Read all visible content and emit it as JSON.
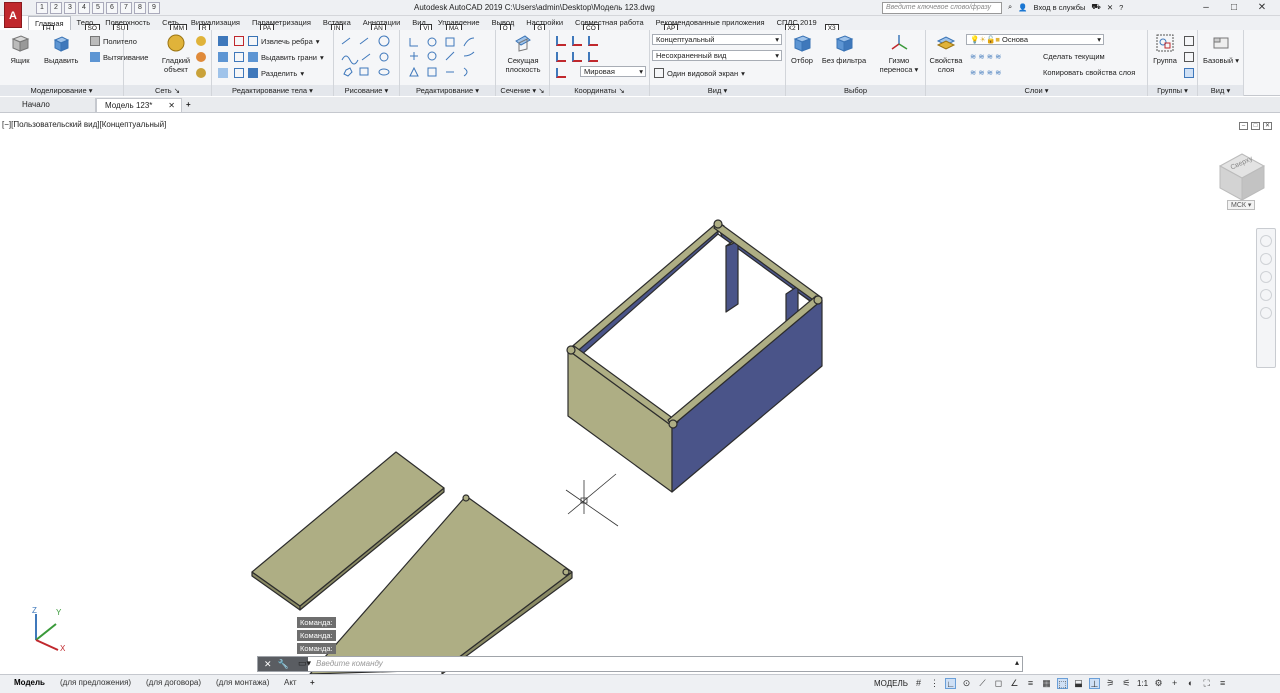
{
  "title_bar": {
    "app_letter": "A",
    "quick_access": [
      "1",
      "2",
      "3",
      "4",
      "5",
      "6",
      "7",
      "8",
      "9"
    ],
    "title": "Autodesk AutoCAD 2019    C:\\Users\\admin\\Desktop\\Модель 123.dwg",
    "search_placeholder": "Введите ключевое слово/фразу",
    "signin": "Вход в службы",
    "help": "?"
  },
  "ribbon_tabs": [
    {
      "label": "Главная",
      "key": "H"
    },
    {
      "label": "Тело",
      "key": "SO"
    },
    {
      "label": "Поверхность",
      "key": "SU"
    },
    {
      "label": "Сеть",
      "key": "MM"
    },
    {
      "label": "Визуализация",
      "key": "R"
    },
    {
      "label": "Параметризация",
      "key": "PA"
    },
    {
      "label": "Вставка",
      "key": "IN"
    },
    {
      "label": "Аннотации",
      "key": "AN"
    },
    {
      "label": "Вид",
      "key": "VI"
    },
    {
      "label": "Управление",
      "key": "MA"
    },
    {
      "label": "Вывод",
      "key": "O"
    },
    {
      "label": "Настройки",
      "key": "G"
    },
    {
      "label": "Совместная работа",
      "key": "CO"
    },
    {
      "label": "Рекомендованные приложения",
      "key": "AP"
    },
    {
      "label": "СПДС 2019",
      "key": "X2"
    }
  ],
  "extra_key": "X3",
  "panels": {
    "modeling": {
      "title": "Моделирование",
      "box": "Ящик",
      "extrude": "Выдавить",
      "polysolid": "Политело",
      "presspull": "Вытягивание"
    },
    "mesh": {
      "title": "Сеть",
      "smooth": "Гладкий объект"
    },
    "solid_edit": {
      "title": "Редактирование тела",
      "extract_edges": "Извлечь ребра",
      "extrude_faces": "Выдавить грани",
      "separate": "Разделить"
    },
    "draw": {
      "title": "Рисование"
    },
    "modify": {
      "title": "Редактирование"
    },
    "section": {
      "title": "Сечение",
      "plane": "Секущая плоскость"
    },
    "coordinates": {
      "title": "Координаты",
      "ucs": "Мировая"
    },
    "view": {
      "title": "Вид",
      "visual_style": "Концептуальный",
      "named_view": "Несохраненный вид",
      "viewports": "Один видовой экран"
    },
    "selection": {
      "title": "Выбор",
      "cull": "Отбор",
      "no_filter": "Без фильтра"
    },
    "gizmo": {
      "label": "Гизмо переноса"
    },
    "layers": {
      "title": "Слои",
      "props": "Свойства слоя",
      "layer_name": "Основа",
      "make_current": "Сделать текущим",
      "copy_props": "Копировать свойства слоя"
    },
    "groups": {
      "title": "Группы",
      "group": "Группа"
    },
    "view2": {
      "title": "Вид",
      "base": "Базовый"
    }
  },
  "doc_tabs": {
    "start": "Начало",
    "model": "Модель 123*",
    "add": "+"
  },
  "viewport": {
    "label": "[−][Пользовательский вид][Концептуальный]",
    "viewcube_face": "Сверху",
    "ucs_label": "МСК",
    "axis_x": "X",
    "axis_y": "Y",
    "axis_z": "Z"
  },
  "command": {
    "history": [
      "Команда:",
      "Команда:",
      "Команда:"
    ],
    "placeholder": "Введите команду"
  },
  "layout_tabs": [
    "Модель",
    "(для предложения)",
    "(для договора)",
    "(для монтажа)",
    "Акт",
    "+"
  ],
  "status": {
    "model": "МОДЕЛЬ",
    "scale": "1:1"
  },
  "colors": {
    "accent": "#c0282d",
    "wall_face": "#4a5489",
    "panel_face": "#aeae84",
    "edge": "#2c2c2c"
  }
}
